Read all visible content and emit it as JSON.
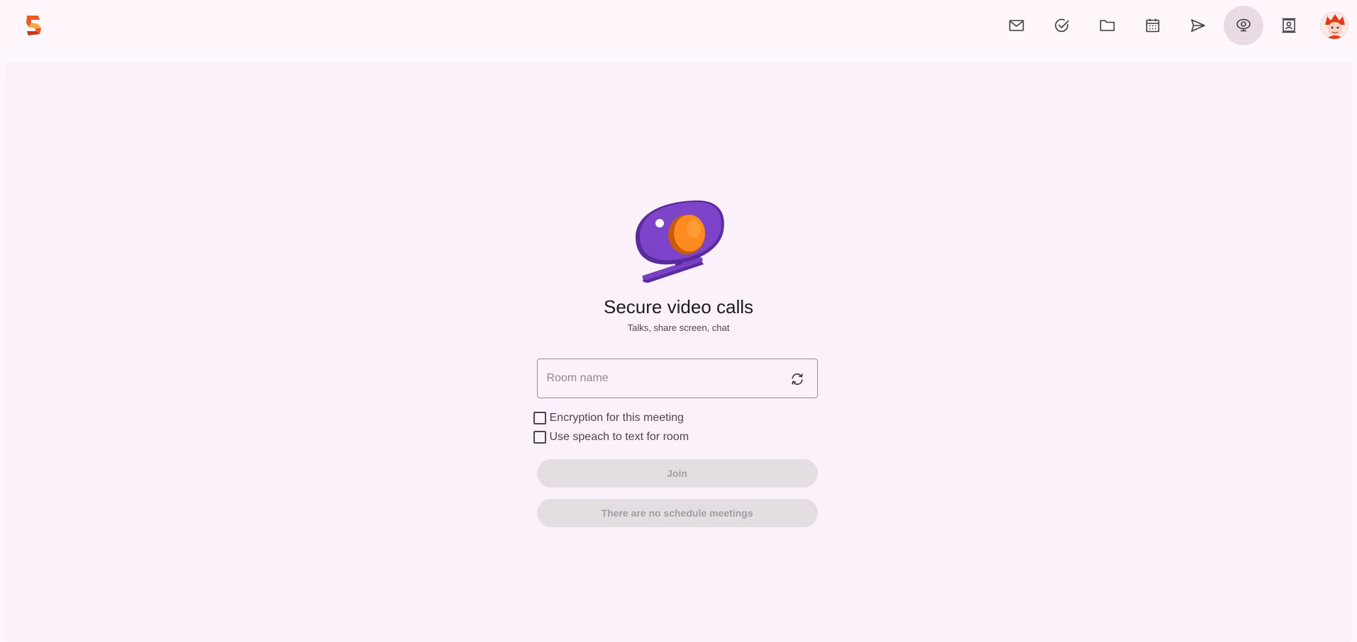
{
  "nav": {
    "items": [
      {
        "name": "mail",
        "icon": "mail-icon"
      },
      {
        "name": "tasks",
        "icon": "check-circle-icon"
      },
      {
        "name": "files",
        "icon": "folder-icon"
      },
      {
        "name": "calendar",
        "icon": "calendar-icon"
      },
      {
        "name": "send",
        "icon": "send-icon"
      },
      {
        "name": "video",
        "icon": "webcam-icon",
        "active": true
      },
      {
        "name": "contacts",
        "icon": "contacts-icon"
      }
    ],
    "active_bg": "#e8dbe6"
  },
  "hero": {
    "icon": "webcam-3d-icon"
  },
  "main": {
    "title": "Secure video calls",
    "subtitle": "Talks, share screen, chat",
    "room_field": {
      "placeholder": "Room name",
      "value": ""
    },
    "checkboxes": [
      {
        "label": "Encryption for this meeting",
        "checked": false
      },
      {
        "label": "Use speach to text for room",
        "checked": false
      }
    ],
    "join_label": "Join",
    "schedule_label": "There are no schedule meetings"
  },
  "colors": {
    "accent": "#7b3fbf",
    "orange": "#ff7a12",
    "background": "#fbf1fa"
  }
}
